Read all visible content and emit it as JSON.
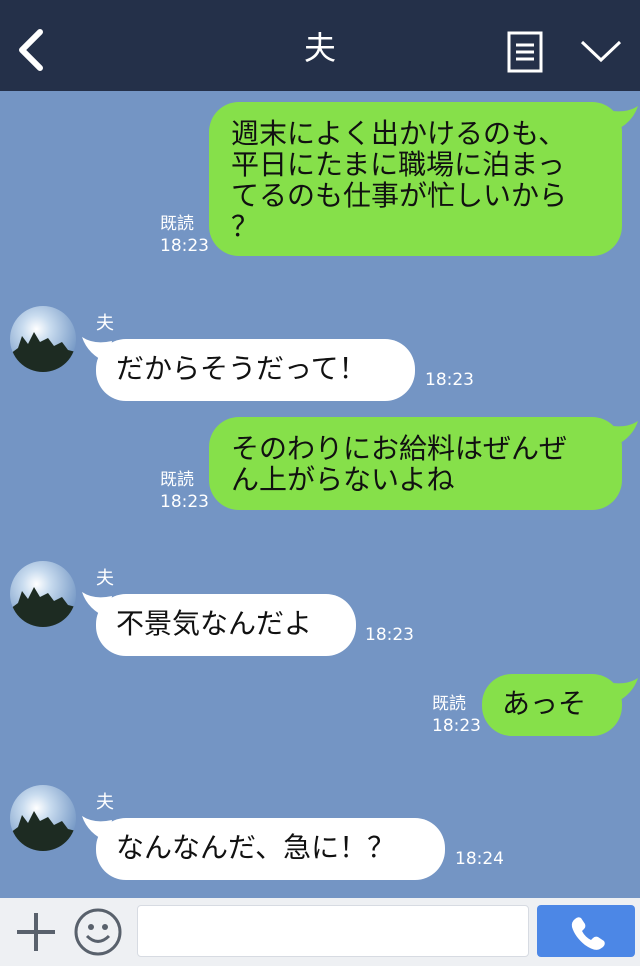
{
  "header": {
    "title": "夫"
  },
  "messages": [
    {
      "side": "me",
      "text": "週末によく出かけるのも、\n平日にたまに職場に泊まっ\nてるのも仕事が忙しいから\n？",
      "read": "既読",
      "time": "18:23"
    },
    {
      "side": "them",
      "sender": "夫",
      "text": "だからそうだって！",
      "time": "18:23"
    },
    {
      "side": "me",
      "text": "そのわりにお給料はぜんぜ\nん上がらないよね",
      "read": "既読",
      "time": "18:23"
    },
    {
      "side": "them",
      "sender": "夫",
      "text": "不景気なんだよ",
      "time": "18:23"
    },
    {
      "side": "me",
      "text": "あっそ",
      "read": "既読",
      "time": "18:23"
    },
    {
      "side": "them",
      "sender": "夫",
      "text": "なんなんだ、急に！？",
      "time": "18:24"
    }
  ],
  "footer": {
    "input_placeholder": ""
  },
  "colors": {
    "header_bg": "#243049",
    "chat_bg": "#7495c4",
    "my_bubble": "#86e04a",
    "their_bubble": "#ffffff",
    "call_button": "#4c87e6"
  },
  "icons": {
    "back": "back-chevron-icon",
    "menu": "menu-list-icon",
    "collapse": "chevron-down-icon",
    "plus": "plus-icon",
    "emoji": "smiley-icon",
    "call": "phone-icon"
  }
}
